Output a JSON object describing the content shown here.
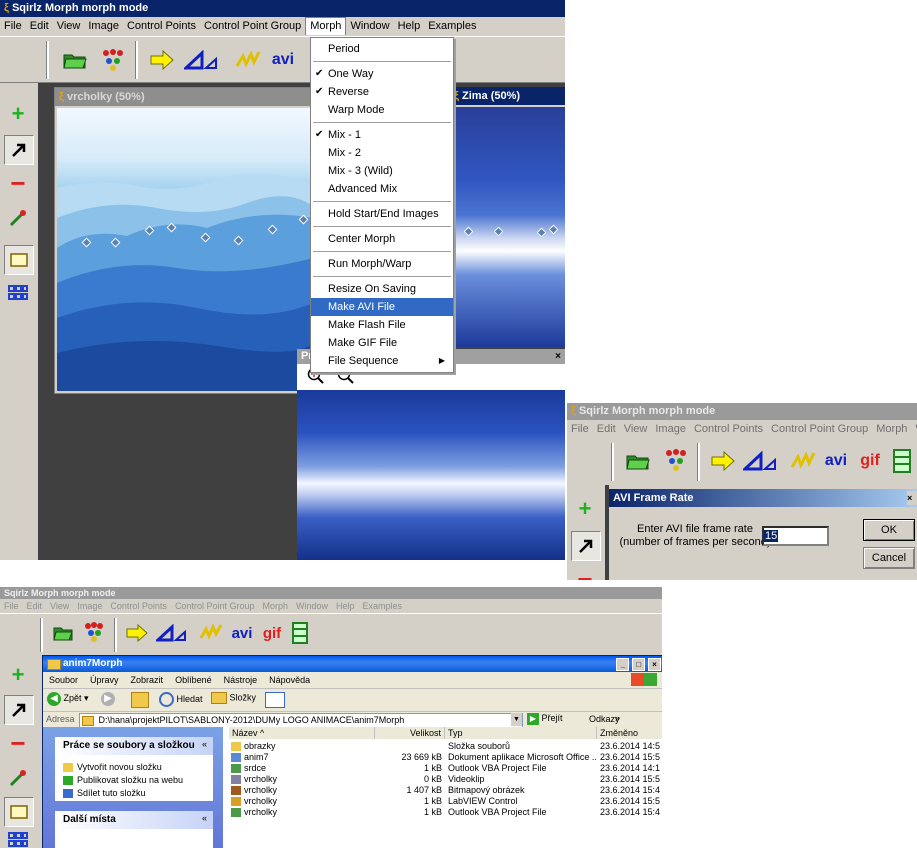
{
  "main_window": {
    "title": "Sqirlz Morph   morph mode",
    "menu": [
      "File",
      "Edit",
      "View",
      "Image",
      "Control Points",
      "Control Point Group",
      "Morph",
      "Window",
      "Help",
      "Examples"
    ],
    "toolbar": {
      "avi_label": "avi",
      "gif_label": "gif"
    },
    "image1_title": "vrcholky  (50%)",
    "image2_title": "Zima  (50%)",
    "preview_title": "Preview",
    "preview_close": "×"
  },
  "morph_menu": {
    "items": [
      {
        "label": "Period"
      },
      {
        "sep": true
      },
      {
        "label": "One Way",
        "check": true
      },
      {
        "label": "Reverse",
        "check": true
      },
      {
        "label": "Warp Mode"
      },
      {
        "sep": true
      },
      {
        "label": "Mix - 1",
        "check": true
      },
      {
        "label": "Mix - 2"
      },
      {
        "label": "Mix - 3 (Wild)"
      },
      {
        "label": "Advanced Mix"
      },
      {
        "sep": true
      },
      {
        "label": "Hold Start/End Images"
      },
      {
        "sep": true
      },
      {
        "label": "Center Morph"
      },
      {
        "sep": true
      },
      {
        "label": "Run Morph/Warp"
      },
      {
        "sep": true
      },
      {
        "label": "Resize On Saving"
      },
      {
        "label": "Make AVI File",
        "selected": true
      },
      {
        "label": "Make Flash File"
      },
      {
        "label": "Make GIF File"
      },
      {
        "label": "File Sequence",
        "submenu": true
      }
    ]
  },
  "second_window": {
    "title": "Sqirlz Morph   morph mode",
    "menu": [
      "File",
      "Edit",
      "View",
      "Image",
      "Control Points",
      "Control Point Group",
      "Morph",
      "W"
    ]
  },
  "avi_dialog": {
    "title": "AVI Frame Rate",
    "prompt_line1": "Enter AVI file frame rate",
    "prompt_line2": "(number of frames per second)",
    "value": "15",
    "ok": "OK",
    "cancel": "Cancel"
  },
  "third_window": {
    "title": "Sqirlz Morph   morph mode",
    "menu": [
      "File",
      "Edit",
      "View",
      "Image",
      "Control Points",
      "Control Point Group",
      "Morph",
      "Window",
      "Help",
      "Examples"
    ]
  },
  "explorer": {
    "title": "anim7Morph",
    "window_buttons": [
      "_",
      "□",
      "×"
    ],
    "menu": [
      "Soubor",
      "Úpravy",
      "Zobrazit",
      "Oblíbené",
      "Nástroje",
      "Nápověda"
    ],
    "back": "Zpět",
    "search": "Hledat",
    "folders": "Složky",
    "address_label": "Adresa",
    "address": "D:\\hana\\projektPILOT\\SABLONY-2012\\DUMy LOGO ANIMACE\\anim7Morph",
    "go": "Přejít",
    "links": "Odkazy",
    "tasks_head": "Práce se soubory a složkou",
    "tasks": [
      "Vytvořit novou složku",
      "Publikovat složku na webu",
      "Sdílet tuto složku"
    ],
    "other_head": "Další místa",
    "columns": [
      "Název",
      "Velikost",
      "Typ",
      "Změněno"
    ],
    "files": [
      {
        "name": "obrazky",
        "size": "",
        "type": "Složka souborů",
        "date": "23.6.2014 14:5"
      },
      {
        "name": "anim7",
        "size": "23 669 kB",
        "type": "Dokument aplikace Microsoft Office ...",
        "date": "23.6.2014 15:5"
      },
      {
        "name": "srdce",
        "size": "1 kB",
        "type": "Outlook VBA Project File",
        "date": "23.6.2014 14:1"
      },
      {
        "name": "vrcholky",
        "size": "0 kB",
        "type": "Videoklip",
        "date": "23.6.2014 15:5"
      },
      {
        "name": "vrcholky",
        "size": "1 407 kB",
        "type": "Bitmapový obrázek",
        "date": "23.6.2014 15:4"
      },
      {
        "name": "vrcholky",
        "size": "1 kB",
        "type": "LabVIEW Control",
        "date": "23.6.2014 15:5"
      },
      {
        "name": "vrcholky",
        "size": "1 kB",
        "type": "Outlook VBA Project File",
        "date": "23.6.2014 15:4"
      }
    ]
  },
  "colors": {
    "titlebar": "#0a246a",
    "menu_highlight": "#316ac5",
    "ui_gray": "#d4d0c8"
  }
}
